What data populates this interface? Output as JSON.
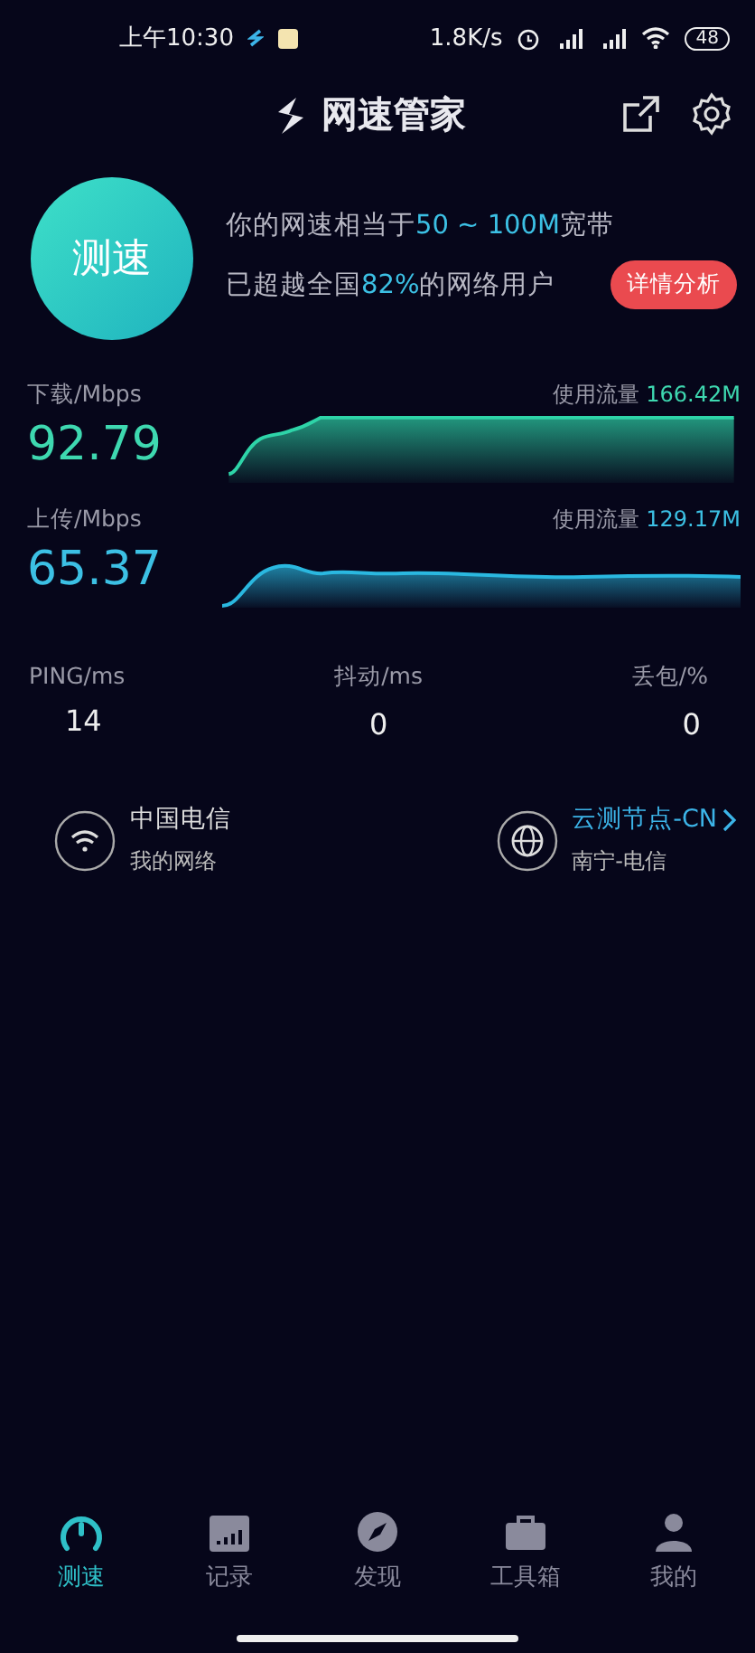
{
  "status_bar": {
    "time": "上午10:30",
    "net_speed": "1.8K/s",
    "battery": "48"
  },
  "header": {
    "title": "网速管家"
  },
  "summary": {
    "button": "测速",
    "line_1": {
      "before": "你的网速相当于",
      "highlight": "50 ~ 100M",
      "after": "宽带"
    },
    "line_2": {
      "before": "已超越全国",
      "highlight": "82%",
      "after": "的网络用户"
    },
    "detail_button": "详情分析"
  },
  "speeds": [
    {
      "kind": "download",
      "label": "下载/Mbps",
      "value": "92.79",
      "usage_label": "使用流量",
      "usage": "166.42M"
    },
    {
      "kind": "upload",
      "label": "上传/Mbps",
      "value": "65.37",
      "usage_label": "使用流量",
      "usage": "129.17M"
    }
  ],
  "stats": [
    {
      "label": "PING/ms",
      "value": "14"
    },
    {
      "label": "抖动/ms",
      "value": "0"
    },
    {
      "label": "丢包/%",
      "value": "0"
    }
  ],
  "network": {
    "carrier": "中国电信",
    "carrier_sub": "我的网络",
    "node": "云测节点-CN",
    "node_sub": "南宁-电信"
  },
  "tabs": [
    {
      "kind": "gauge",
      "label": "测速",
      "selected": true
    },
    {
      "kind": "calendar",
      "label": "记录",
      "selected": false
    },
    {
      "kind": "compass",
      "label": "发现",
      "selected": false
    },
    {
      "kind": "toolbox",
      "label": "工具箱",
      "selected": false
    },
    {
      "kind": "person",
      "label": "我的",
      "selected": false
    }
  ]
}
